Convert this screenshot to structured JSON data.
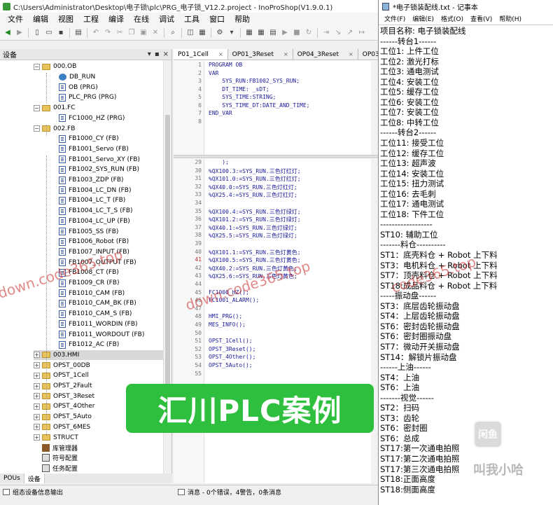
{
  "ide": {
    "title": "C:\\Users\\Administrator\\Desktop\\电子锁\\plc\\PRG_电子锁_V12.2.project - InoProShop(V1.9.0.1)",
    "menu": [
      "文件",
      "编辑",
      "视图",
      "工程",
      "编译",
      "在线",
      "调试",
      "工具",
      "窗口",
      "帮助"
    ],
    "device_panel_title": "设备",
    "panel_buttons": [
      "▾",
      "▪",
      "×"
    ],
    "tree": [
      {
        "label": "000.OB",
        "icon": "folder",
        "depth": 1,
        "exp": "−"
      },
      {
        "label": "DB_RUN",
        "icon": "db",
        "depth": 2
      },
      {
        "label": "OB (PRG)",
        "icon": "pou",
        "depth": 2
      },
      {
        "label": "PLC_PRG (PRG)",
        "icon": "pou",
        "depth": 2
      },
      {
        "label": "001.FC",
        "icon": "folder",
        "depth": 1,
        "exp": "−"
      },
      {
        "label": "FC1000_HZ (PRG)",
        "icon": "pou",
        "depth": 2
      },
      {
        "label": "002.FB",
        "icon": "folder",
        "depth": 1,
        "exp": "−"
      },
      {
        "label": "FB1000_CY (FB)",
        "icon": "pou",
        "depth": 2
      },
      {
        "label": "FB1001_Servo (FB)",
        "icon": "pou",
        "depth": 2
      },
      {
        "label": "FB1001_Servo_XY (FB)",
        "icon": "pou",
        "depth": 2
      },
      {
        "label": "FB1002_SYS_RUN (FB)",
        "icon": "pou",
        "depth": 2
      },
      {
        "label": "FB1003_ZDP (FB)",
        "icon": "pou",
        "depth": 2
      },
      {
        "label": "FB1004_LC_DN (FB)",
        "icon": "pou",
        "depth": 2
      },
      {
        "label": "FB1004_LC_T (FB)",
        "icon": "pou",
        "depth": 2
      },
      {
        "label": "FB1004_LC_T_S (FB)",
        "icon": "pou",
        "depth": 2
      },
      {
        "label": "FB1004_LC_UP (FB)",
        "icon": "pou",
        "depth": 2
      },
      {
        "label": "FB1005_SS (FB)",
        "icon": "pou",
        "depth": 2
      },
      {
        "label": "FB1006_Robot (FB)",
        "icon": "pou",
        "depth": 2
      },
      {
        "label": "FB1007_INPUT (FB)",
        "icon": "pou",
        "depth": 2
      },
      {
        "label": "FB1007_OUTPUT (FB)",
        "icon": "pou",
        "depth": 2
      },
      {
        "label": "FB1008_CT (FB)",
        "icon": "pou",
        "depth": 2
      },
      {
        "label": "FB1009_CR (FB)",
        "icon": "pou",
        "depth": 2
      },
      {
        "label": "FB1010_CAM (FB)",
        "icon": "pou",
        "depth": 2
      },
      {
        "label": "FB1010_CAM_BK (FB)",
        "icon": "pou",
        "depth": 2
      },
      {
        "label": "FB1010_CAM_S (FB)",
        "icon": "pou",
        "depth": 2
      },
      {
        "label": "FB1011_WORDIN (FB)",
        "icon": "pou",
        "depth": 2
      },
      {
        "label": "FB1011_WORDOUT (FB)",
        "icon": "pou",
        "depth": 2
      },
      {
        "label": "FB1012_AC (FB)",
        "icon": "pou",
        "depth": 2
      },
      {
        "label": "003.HMI",
        "icon": "folder",
        "depth": 1,
        "exp": "+",
        "selected": true
      },
      {
        "label": "OPST_00DB",
        "icon": "folder",
        "depth": 1,
        "exp": "+"
      },
      {
        "label": "OPST_1Cell",
        "icon": "folder",
        "depth": 1,
        "exp": "+"
      },
      {
        "label": "OPST_2Fault",
        "icon": "folder",
        "depth": 1,
        "exp": "+"
      },
      {
        "label": "OPST_3Reset",
        "icon": "folder",
        "depth": 1,
        "exp": "+"
      },
      {
        "label": "OPST_4Other",
        "icon": "folder",
        "depth": 1,
        "exp": "+"
      },
      {
        "label": "OPST_5Auto",
        "icon": "folder",
        "depth": 1,
        "exp": "+"
      },
      {
        "label": "OPST_6MES",
        "icon": "folder",
        "depth": 1,
        "exp": "+"
      },
      {
        "label": "STRUCT",
        "icon": "folder",
        "depth": 1,
        "exp": "+"
      },
      {
        "label": "库管理器",
        "icon": "lib",
        "depth": 1
      },
      {
        "label": "符号配置",
        "icon": "sym",
        "depth": 1
      },
      {
        "label": "任务配置",
        "icon": "sym",
        "depth": 1
      }
    ],
    "bottom_tabs": [
      "POUs",
      "设备"
    ],
    "status": {
      "left": "组态设备信息输出",
      "messages": "消息 - 0个错误，4警告，0条消息"
    },
    "editor_tabs": [
      {
        "label": "P01_1Cell",
        "active": true
      },
      {
        "label": "OP01_3Reset"
      },
      {
        "label": "OP04_3Reset"
      },
      {
        "label": "OP03_R2"
      }
    ],
    "decl_lines": [
      {
        "n": "1",
        "t": "PROGRAM OB",
        "kw": true
      },
      {
        "n": "2",
        "t": "VAR",
        "kw": true
      },
      {
        "n": "3",
        "t": "    SYS_RUN:FB1002_SYS_RUN;"
      },
      {
        "n": "4",
        "t": "    DT_TIME: _sDT;"
      },
      {
        "n": "5",
        "t": "    SYS_TIME:STRING;"
      },
      {
        "n": "6",
        "t": "    SYS_TIME_DT:DATE_AND_TIME;"
      },
      {
        "n": "7",
        "t": "END_VAR",
        "kw": true
      },
      {
        "n": "8",
        "t": ""
      }
    ],
    "code_lines": [
      {
        "n": "29",
        "t": "    );"
      },
      {
        "n": "30",
        "t": "%QX100.3:=SYS_RUN.三色灯红灯;"
      },
      {
        "n": "31",
        "t": "%QX101.0:=SYS_RUN.三色灯红灯;"
      },
      {
        "n": "32",
        "t": "%QX40.0:=SYS_RUN.三色灯红灯;"
      },
      {
        "n": "33",
        "t": "%QX25.4:=SYS_RUN.三色灯红灯;"
      },
      {
        "n": "34",
        "t": ""
      },
      {
        "n": "35",
        "t": "%QX100.4:=SYS_RUN.三色灯绿灯;"
      },
      {
        "n": "36",
        "t": "%QX101.2:=SYS_RUN.三色灯绿灯;"
      },
      {
        "n": "37",
        "t": "%QX40.1:=SYS_RUN.三色灯绿灯;"
      },
      {
        "n": "38",
        "t": "%QX25.5:=SYS_RUN.三色灯绿灯;"
      },
      {
        "n": "39",
        "t": ""
      },
      {
        "n": "40",
        "t": "%QX101.1:=SYS_RUN.三色灯黄色;"
      },
      {
        "n": "41",
        "t": "%QX100.5:=SYS_RUN.三色灯黄色;",
        "red": true
      },
      {
        "n": "42",
        "t": "%QX40.2:=SYS_RUN.三色灯黄色;"
      },
      {
        "n": "43",
        "t": "%QX25.6:=SYS_RUN.三色灯黄色;"
      },
      {
        "n": "44",
        "t": ""
      },
      {
        "n": "45",
        "t": "FC1000_HZ();"
      },
      {
        "n": "46",
        "t": "FC1001_ALARM();"
      },
      {
        "n": "47",
        "t": ""
      },
      {
        "n": "48",
        "t": "HMI_PRG();"
      },
      {
        "n": "49",
        "t": "MES_INFO();"
      },
      {
        "n": "50",
        "t": ""
      },
      {
        "n": "51",
        "t": "OPST_1Cell();"
      },
      {
        "n": "52",
        "t": "OPST_3Reset();"
      },
      {
        "n": "53",
        "t": "OPST_4Other();"
      },
      {
        "n": "54",
        "t": "OPST_5Auto();"
      },
      {
        "n": "55",
        "t": ""
      }
    ]
  },
  "overlay": {
    "banner": "汇川PLC案例",
    "watermark_1": "down.code365.top",
    "watermark_2": "down.code365.top",
    "watermark_3": "code365.top",
    "bili_logo": "闲鱼",
    "uploader": "叫我小哈"
  },
  "notepad": {
    "title": "*电子锁装配线.txt - 记事本",
    "menu": [
      "文件(F)",
      "编辑(E)",
      "格式(O)",
      "查看(V)",
      "帮助(H)"
    ],
    "lines": [
      "项目名称: 电子锁装配线",
      "------转台1------",
      "工位1: 上件工位",
      "工位2: 激光打标",
      "工位3: 通电测试",
      "工位4: 安装工位",
      "工位5: 缓存工位",
      "工位6: 安装工位",
      "工位7: 安装工位",
      "工位8: 中转工位",
      "------转台2------",
      "工位11: 接受工位",
      "工位12: 缓存工位",
      "工位13: 超声波",
      "工位14: 安装工位",
      "工位15: 扭力测试",
      "工位16: 去毛刺",
      "工位17: 通电测试",
      "工位18: 下件工位",
      "------------------",
      "ST10: 辅助工位",
      "-------料仓----------",
      "ST1：底壳料仓 + Robot 上下料",
      "ST3：电机料仓 + Robot 上下料",
      "ST7：顶壳料仓 + Robot 上下料",
      "ST18:成品料仓 + Robot 上下料",
      "-----振动盘------",
      "ST3：底层齿轮振动盘",
      "ST4：上层齿轮振动盘",
      "ST6：密封齿轮振动盘",
      "ST6：密封圈振动盘",
      "ST7：微动开关振动盘",
      "ST14：解锁片振动盘",
      "------上油------",
      "ST4：上油",
      "ST6：上油",
      "-------视觉------",
      "ST2：扫码",
      "ST3：齿轮",
      "ST6：密封圈",
      "ST6：总成",
      "ST17:第一次通电拍照",
      "ST17:第二次通电拍照",
      "ST17:第三次通电拍照",
      "ST18:正面高度",
      "ST18:侧面高度"
    ]
  }
}
